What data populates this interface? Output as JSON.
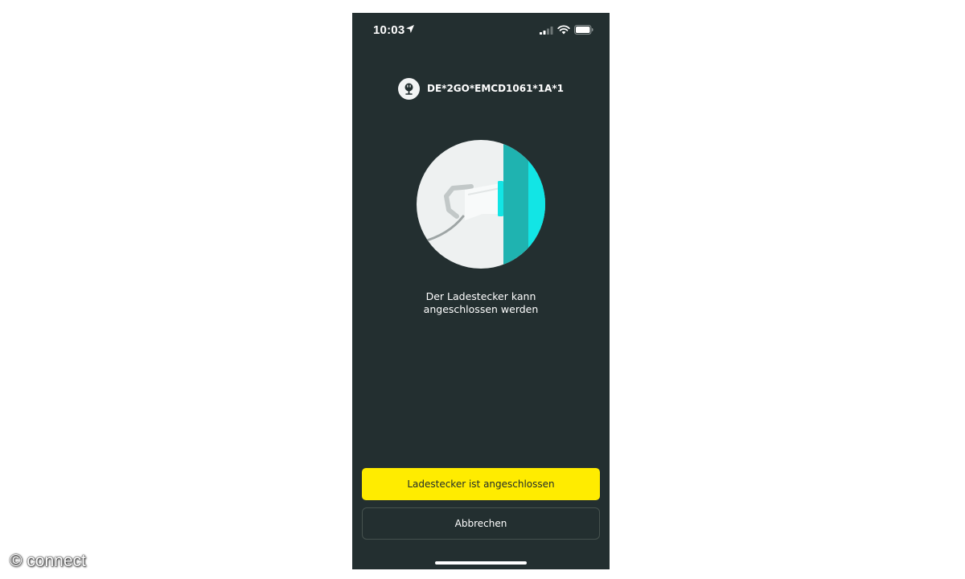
{
  "status_bar": {
    "time": "10:03",
    "icons": [
      "location-arrow-icon",
      "cellular-signal-icon",
      "wifi-icon",
      "battery-icon"
    ]
  },
  "station": {
    "icon": "charging-plug-icon",
    "id": "DE*2GO*EMCD1061*1A*1"
  },
  "illustration": {
    "icon": "charging-connector-illustration"
  },
  "message": {
    "line1": "Der Ladestecker kann",
    "line2": "angeschlossen werden"
  },
  "actions": {
    "confirm_label": "Ladestecker ist angeschlossen",
    "cancel_label": "Abbrechen"
  },
  "watermark": "© connect",
  "colors": {
    "background": "#232f30",
    "accent_yellow": "#ffec00",
    "teal": "#1fb3b0",
    "cyan": "#12e5e5",
    "circle": "#eef1f1"
  }
}
